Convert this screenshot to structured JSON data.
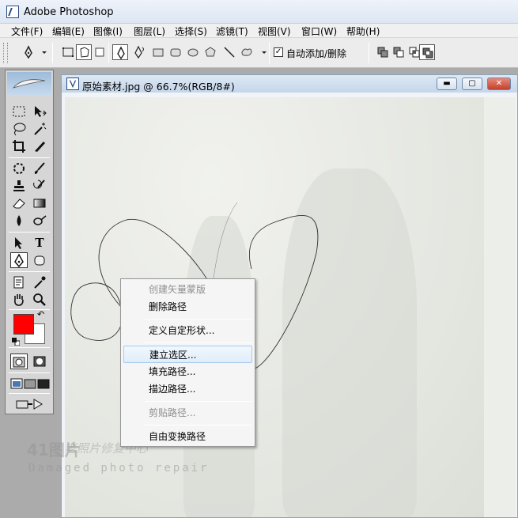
{
  "app": {
    "title": "Adobe Photoshop"
  },
  "menu": [
    "文件(F)",
    "编辑(E)",
    "图像(I)",
    "图层(L)",
    "选择(S)",
    "滤镜(T)",
    "视图(V)",
    "窗口(W)",
    "帮助(H)"
  ],
  "options": {
    "auto_add_label": "自动添加/删除",
    "auto_add_checked": true
  },
  "document": {
    "title": "原始素材.jpg @ 66.7%(RGB/8#)",
    "minimize": "▬",
    "maximize": "▢",
    "close": "✕"
  },
  "tools": [
    "rect-marquee",
    "move",
    "lasso",
    "magic-wand",
    "crop",
    "slice",
    "healing-brush",
    "brush",
    "clone-stamp",
    "history-brush",
    "eraser",
    "gradient",
    "blur",
    "dodge",
    "path-select",
    "type",
    "pen",
    "shape",
    "notes",
    "eyedropper",
    "hand",
    "zoom"
  ],
  "type_tool_glyph": "T",
  "colors": {
    "foreground": "#ff0000",
    "background": "#ffffff"
  },
  "context_menu": {
    "items": [
      {
        "label": "创建矢量蒙版",
        "disabled": true
      },
      {
        "label": "删除路径",
        "disabled": false
      },
      {
        "label": "定义自定形状...",
        "disabled": false
      },
      {
        "label": "建立选区...",
        "disabled": false,
        "highlighted": true
      },
      {
        "label": "填充路径...",
        "disabled": false
      },
      {
        "label": "描边路径...",
        "disabled": false
      },
      {
        "label": "剪贴路径...",
        "disabled": true
      },
      {
        "label": "自由变换路径",
        "disabled": false
      }
    ]
  },
  "watermark": {
    "main": "41图片",
    "cn": "老照片修复中心",
    "sub": "Damaged photo repair"
  }
}
